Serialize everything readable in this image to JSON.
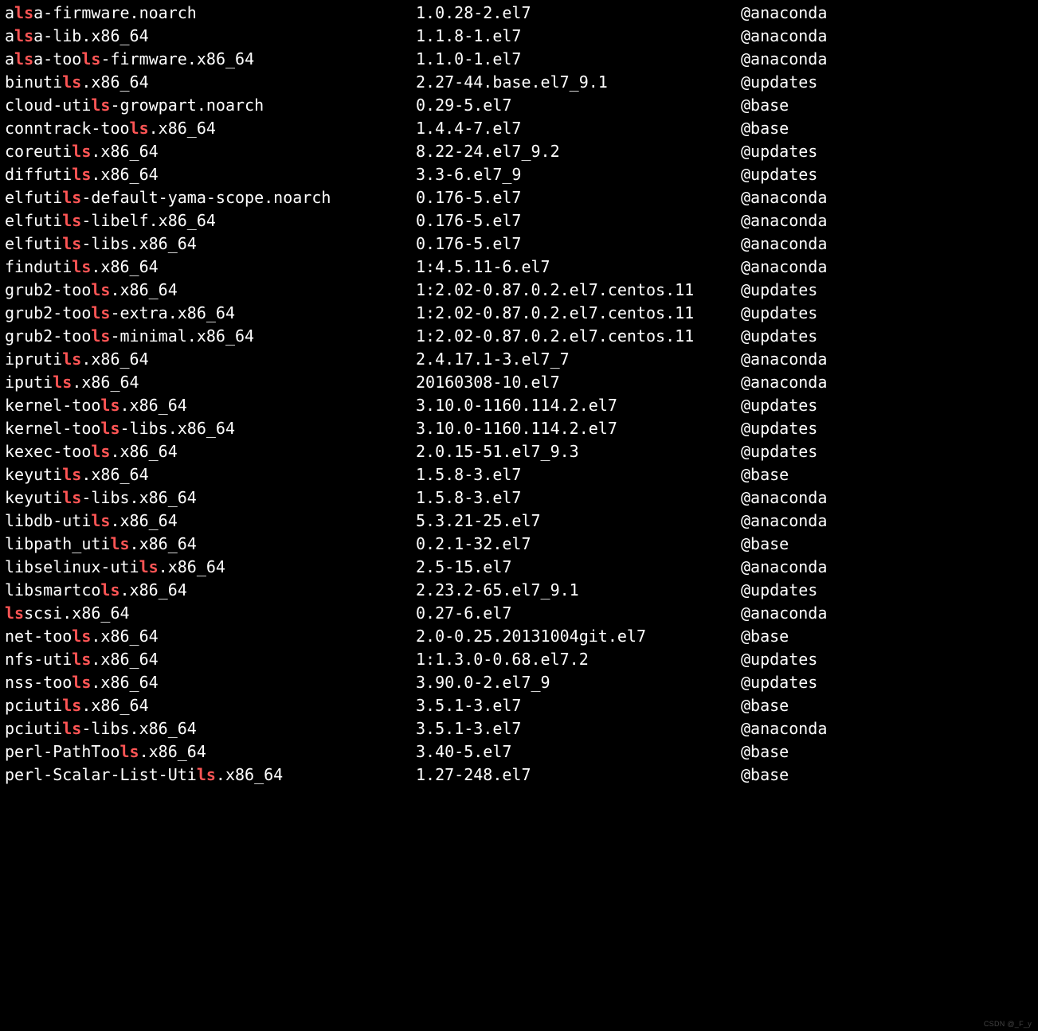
{
  "highlight": "ls",
  "watermark": "CSDN @_F_y",
  "packages": [
    {
      "name": "alsa-firmware.noarch",
      "version": "1.0.28-2.el7",
      "repo": "@anaconda"
    },
    {
      "name": "alsa-lib.x86_64",
      "version": "1.1.8-1.el7",
      "repo": "@anaconda"
    },
    {
      "name": "alsa-tools-firmware.x86_64",
      "version": "1.1.0-1.el7",
      "repo": "@anaconda"
    },
    {
      "name": "binutils.x86_64",
      "version": "2.27-44.base.el7_9.1",
      "repo": "@updates"
    },
    {
      "name": "cloud-utils-growpart.noarch",
      "version": "0.29-5.el7",
      "repo": "@base"
    },
    {
      "name": "conntrack-tools.x86_64",
      "version": "1.4.4-7.el7",
      "repo": "@base"
    },
    {
      "name": "coreutils.x86_64",
      "version": "8.22-24.el7_9.2",
      "repo": "@updates"
    },
    {
      "name": "diffutils.x86_64",
      "version": "3.3-6.el7_9",
      "repo": "@updates"
    },
    {
      "name": "elfutils-default-yama-scope.noarch",
      "version": "0.176-5.el7",
      "repo": "@anaconda"
    },
    {
      "name": "elfutils-libelf.x86_64",
      "version": "0.176-5.el7",
      "repo": "@anaconda"
    },
    {
      "name": "elfutils-libs.x86_64",
      "version": "0.176-5.el7",
      "repo": "@anaconda"
    },
    {
      "name": "findutils.x86_64",
      "version": "1:4.5.11-6.el7",
      "repo": "@anaconda"
    },
    {
      "name": "grub2-tools.x86_64",
      "version": "1:2.02-0.87.0.2.el7.centos.11",
      "repo": "@updates"
    },
    {
      "name": "grub2-tools-extra.x86_64",
      "version": "1:2.02-0.87.0.2.el7.centos.11",
      "repo": "@updates"
    },
    {
      "name": "grub2-tools-minimal.x86_64",
      "version": "1:2.02-0.87.0.2.el7.centos.11",
      "repo": "@updates"
    },
    {
      "name": "iprutils.x86_64",
      "version": "2.4.17.1-3.el7_7",
      "repo": "@anaconda"
    },
    {
      "name": "iputils.x86_64",
      "version": "20160308-10.el7",
      "repo": "@anaconda"
    },
    {
      "name": "kernel-tools.x86_64",
      "version": "3.10.0-1160.114.2.el7",
      "repo": "@updates"
    },
    {
      "name": "kernel-tools-libs.x86_64",
      "version": "3.10.0-1160.114.2.el7",
      "repo": "@updates"
    },
    {
      "name": "kexec-tools.x86_64",
      "version": "2.0.15-51.el7_9.3",
      "repo": "@updates"
    },
    {
      "name": "keyutils.x86_64",
      "version": "1.5.8-3.el7",
      "repo": "@base"
    },
    {
      "name": "keyutils-libs.x86_64",
      "version": "1.5.8-3.el7",
      "repo": "@anaconda"
    },
    {
      "name": "libdb-utils.x86_64",
      "version": "5.3.21-25.el7",
      "repo": "@anaconda"
    },
    {
      "name": "libpath_utils.x86_64",
      "version": "0.2.1-32.el7",
      "repo": "@base"
    },
    {
      "name": "libselinux-utils.x86_64",
      "version": "2.5-15.el7",
      "repo": "@anaconda"
    },
    {
      "name": "libsmartcols.x86_64",
      "version": "2.23.2-65.el7_9.1",
      "repo": "@updates"
    },
    {
      "name": "lsscsi.x86_64",
      "version": "0.27-6.el7",
      "repo": "@anaconda"
    },
    {
      "name": "net-tools.x86_64",
      "version": "2.0-0.25.20131004git.el7",
      "repo": "@base"
    },
    {
      "name": "nfs-utils.x86_64",
      "version": "1:1.3.0-0.68.el7.2",
      "repo": "@updates"
    },
    {
      "name": "nss-tools.x86_64",
      "version": "3.90.0-2.el7_9",
      "repo": "@updates"
    },
    {
      "name": "pciutils.x86_64",
      "version": "3.5.1-3.el7",
      "repo": "@base"
    },
    {
      "name": "pciutils-libs.x86_64",
      "version": "3.5.1-3.el7",
      "repo": "@anaconda"
    },
    {
      "name": "perl-PathTools.x86_64",
      "version": "3.40-5.el7",
      "repo": "@base"
    },
    {
      "name": "perl-Scalar-List-Utils.x86_64",
      "version": "1.27-248.el7",
      "repo": "@base"
    }
  ]
}
